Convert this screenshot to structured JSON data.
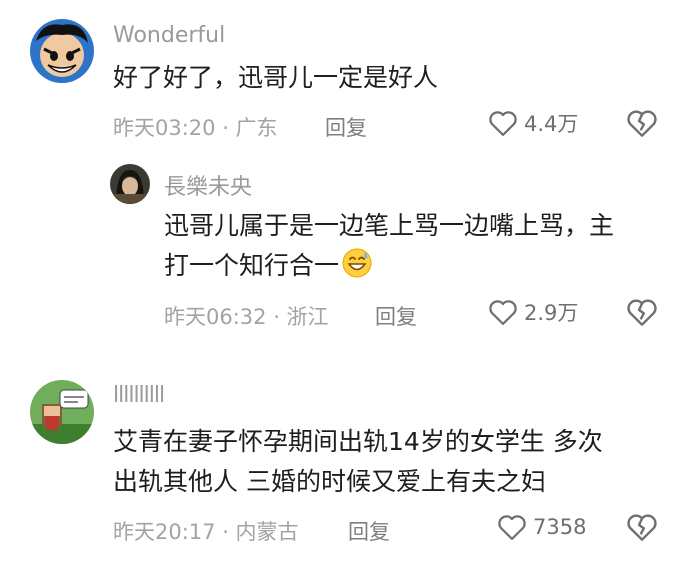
{
  "comments": [
    {
      "username": "Wonderful",
      "text_lines": [
        "好了好了，迅哥儿一定是好人"
      ],
      "time_location": "昨天03:20 · 广东",
      "reply_label": "回复",
      "like_count": "4.4万",
      "avatar_icon": "cartoon-avatar-icon",
      "replies": [
        {
          "username": "長樂未央",
          "text_lines": [
            "迅哥儿属于是一边笔上骂一边嘴上骂，主",
            "打一个知行合一"
          ],
          "emoji": "grinning-sweat-emoji-icon",
          "time_location": "昨天06:32 · 浙江",
          "reply_label": "回复",
          "like_count": "2.9万",
          "avatar_icon": "portrait-avatar-icon"
        }
      ]
    },
    {
      "username": "llllllllll",
      "text_lines": [
        "艾青在妻子怀孕期间出轨14岁的女学生 多次",
        "出轨其他人 三婚的时候又爱上有夫之妇"
      ],
      "time_location": "昨天20:17 · 内蒙古",
      "reply_label": "回复",
      "like_count": "7358",
      "avatar_icon": "pixel-character-avatar-icon"
    }
  ],
  "colors": {
    "username": "#9a9a9a",
    "content": "#1e1e1e",
    "meta": "#a3a3a3",
    "icon": "#6f6f6f"
  }
}
